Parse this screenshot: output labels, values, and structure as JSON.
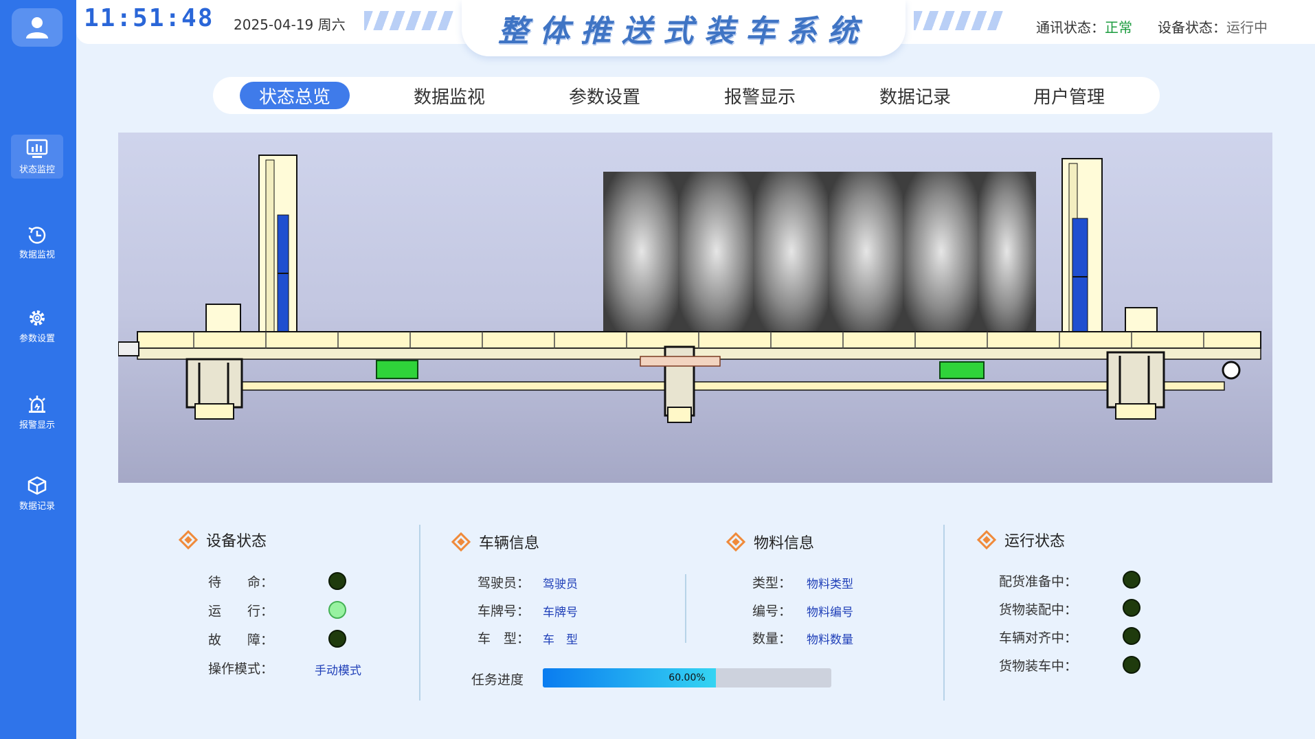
{
  "header": {
    "time": "11:51:48",
    "date": "2025-04-19 周六",
    "title": "整体推送式装车系统",
    "comm_label": "通讯状态：",
    "comm_value": "正常",
    "device_label": "设备状态：",
    "device_value": "运行中"
  },
  "sidebar": {
    "items": [
      {
        "label": "状态监控",
        "icon": "monitor-icon"
      },
      {
        "label": "数据监视",
        "icon": "clock-icon"
      },
      {
        "label": "参数设置",
        "icon": "gear-icon"
      },
      {
        "label": "报警显示",
        "icon": "alarm-icon"
      },
      {
        "label": "数据记录",
        "icon": "box-icon"
      }
    ]
  },
  "tabs": [
    "状态总览",
    "数据监视",
    "参数设置",
    "报警显示",
    "数据记录",
    "用户管理"
  ],
  "device_status": {
    "title": "设备状态",
    "items": [
      {
        "label": "待　　命：",
        "on": false
      },
      {
        "label": "运　　行：",
        "on": true
      },
      {
        "label": "故　　障：",
        "on": false
      }
    ],
    "mode_label": "操作模式：",
    "mode_value": "手动模式"
  },
  "vehicle": {
    "title": "车辆信息",
    "driver_label": "驾驶员：",
    "driver_value": "驾驶员",
    "plate_label": "车牌号：",
    "plate_value": "车牌号",
    "type_label": "车　型：",
    "type_value": "车　型"
  },
  "material": {
    "title": "物料信息",
    "type_label": "类型：",
    "type_value": "物料类型",
    "code_label": "编号：",
    "code_value": "物料编号",
    "qty_label": "数量：",
    "qty_value": "物料数量"
  },
  "task": {
    "label": "任务进度",
    "progress": 0.6,
    "progress_text": "60.00%"
  },
  "run_status": {
    "title": "运行状态",
    "items": [
      {
        "label": "配货准备中：",
        "on": false
      },
      {
        "label": "货物装配中：",
        "on": false
      },
      {
        "label": "车辆对齐中：",
        "on": false
      },
      {
        "label": "货物装车中：",
        "on": false
      }
    ]
  },
  "colors": {
    "sidebar": "#2f74ea",
    "accent": "#3f7bea",
    "ok": "#1c9c3f",
    "lamp_on": "#98f2a1",
    "lamp_off": "#1f3b0d",
    "diamond": "#f08a3a"
  }
}
